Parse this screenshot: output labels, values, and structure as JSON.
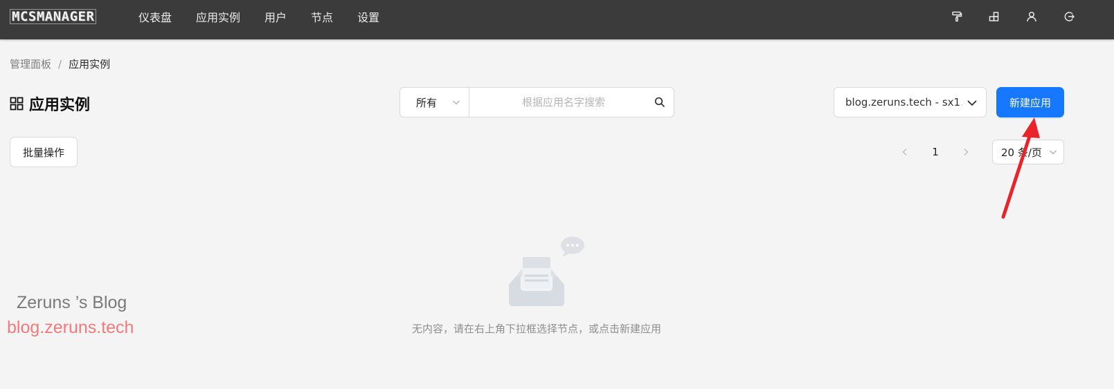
{
  "app": {
    "logo_text": "MCSMANAGER"
  },
  "nav": {
    "items": [
      "仪表盘",
      "应用实例",
      "用户",
      "节点",
      "设置"
    ]
  },
  "top_icons": [
    "paint-roller-icon",
    "blocks-icon",
    "user-icon",
    "logout-icon"
  ],
  "breadcrumb": {
    "root": "管理面板",
    "separator": "/",
    "current": "应用实例"
  },
  "page": {
    "title": "应用实例",
    "title_icon": "grid-icon"
  },
  "search": {
    "filter_value": "所有",
    "placeholder": "根据应用名字搜索",
    "value": ""
  },
  "node_select": {
    "value": "blog.zeruns.tech - sx1..."
  },
  "create_button": {
    "label": "新建应用",
    "color": "#1677ff"
  },
  "batch_button": {
    "label": "批量操作"
  },
  "pagination": {
    "current_page": "1",
    "page_size": "20 条/页"
  },
  "empty": {
    "message": "无内容，请在右上角下拉框选择节点，或点击新建应用"
  },
  "watermark": {
    "title": "Zeruns ’s Blog",
    "url": "blog.zeruns.tech",
    "url_color": "#f27a7a"
  },
  "annotation": {
    "arrow_color": "#e8232a"
  }
}
